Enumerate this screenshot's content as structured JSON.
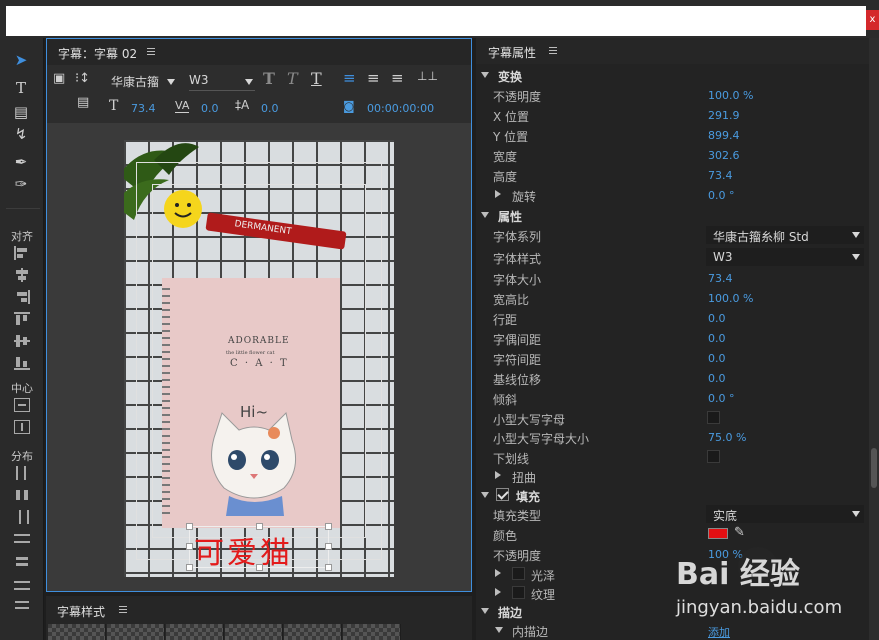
{
  "window": {
    "close_label": "x"
  },
  "left_toolbar": {
    "align_label": "对齐",
    "center_label": "中心",
    "distribute_label": "分布"
  },
  "title_panel": {
    "tab_label": "字幕：字幕 02",
    "font_family": "华康古籀",
    "font_style": "W3",
    "font_size": "73.4",
    "kerning": "0.0",
    "leading": "0.0",
    "timecode": "00:00:00:00",
    "subtitle_text": "可爱猫",
    "notebook_line1": "ADORABLE",
    "notebook_line2": "the little flower cat",
    "notebook_line3": "C · A · T",
    "notebook_hi": "Hi~",
    "marker_label": "DERMANENT"
  },
  "styles_panel": {
    "tab_label": "字幕样式"
  },
  "properties": {
    "tab_label": "字幕属性",
    "transform": {
      "header": "变换",
      "rows": [
        {
          "label": "不透明度",
          "value": "100.0 %"
        },
        {
          "label": "X 位置",
          "value": "291.9"
        },
        {
          "label": "Y 位置",
          "value": "899.4"
        },
        {
          "label": "宽度",
          "value": "302.6"
        },
        {
          "label": "高度",
          "value": "73.4"
        }
      ],
      "rotation": {
        "label": "旋转",
        "value": "0.0 °"
      }
    },
    "attributes": {
      "header": "属性",
      "font_family_label": "字体系列",
      "font_family_value": "华康古籀糸柳 Std",
      "font_style_label": "字体样式",
      "font_style_value": "W3",
      "rows": [
        {
          "label": "字体大小",
          "value": "73.4"
        },
        {
          "label": "宽高比",
          "value": "100.0 %"
        },
        {
          "label": "行距",
          "value": "0.0"
        },
        {
          "label": "字偶间距",
          "value": "0.0"
        },
        {
          "label": "字符间距",
          "value": "0.0"
        },
        {
          "label": "基线位移",
          "value": "0.0"
        },
        {
          "label": "倾斜",
          "value": "0.0 °"
        }
      ],
      "smallcaps_label": "小型大写字母",
      "smallcaps_size_label": "小型大写字母大小",
      "smallcaps_size_value": "75.0 %",
      "underline_label": "下划线",
      "distort_label": "扭曲"
    },
    "fill": {
      "header": "填充",
      "type_label": "填充类型",
      "type_value": "实底",
      "color_label": "颜色",
      "color_value": "#e30f12",
      "opacity_label": "不透明度",
      "opacity_value": "100 %",
      "sheen_label": "光泽",
      "texture_label": "纹理"
    },
    "stroke": {
      "header": "描边",
      "inner_label": "内描边",
      "add_link": "添加"
    }
  },
  "watermark": {
    "logo": "Bai 经验",
    "site": "jingyan.baidu.com"
  }
}
